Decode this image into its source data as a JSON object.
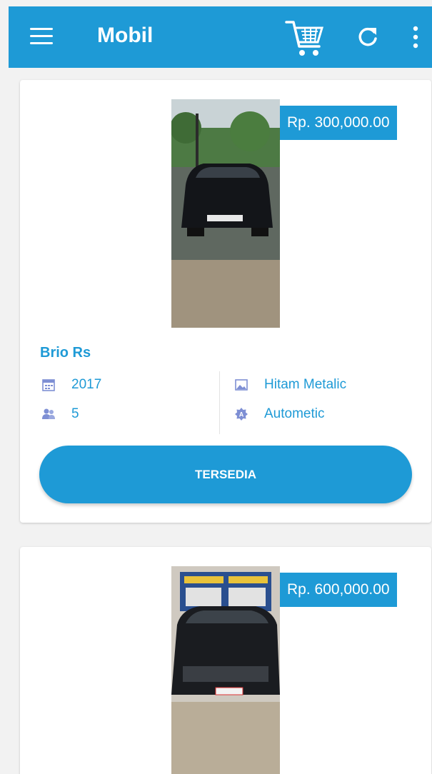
{
  "appbar": {
    "title": "Mobil",
    "menu_icon": "hamburger-menu-icon",
    "cart_icon": "shopping-cart-icon",
    "refresh_icon": "refresh-icon",
    "more_icon": "more-vert-icon",
    "color": "#1e9ad6"
  },
  "cars": [
    {
      "price": "Rp. 300,000.00",
      "name": "Brio Rs",
      "year": "2017",
      "seats": "5",
      "color": "Hitam Metalic",
      "transmission": "Autometic",
      "status": "TERSEDIA"
    },
    {
      "price": "Rp. 600,000.00"
    }
  ],
  "colors": {
    "accent": "#1e9ad6",
    "background": "#f2f2f2",
    "card": "#ffffff"
  }
}
